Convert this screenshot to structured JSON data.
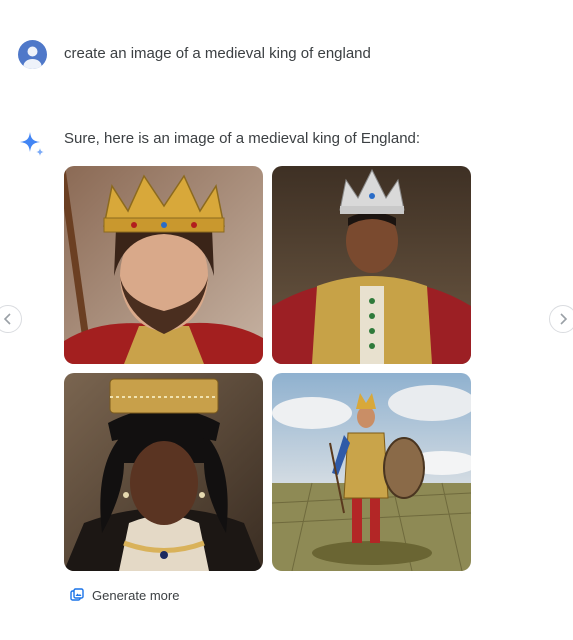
{
  "conversation": {
    "user_prompt": "create an image of a medieval king of england",
    "response_text": "Sure, here is an image of a medieval king of England:"
  },
  "images": [
    {
      "icon": "bearded-king-portrait"
    },
    {
      "icon": "king-in-jeweled-crown-portrait"
    },
    {
      "icon": "queen-in-crown-portrait"
    },
    {
      "icon": "armored-warrior-with-shield"
    }
  ],
  "actions": {
    "generate_more_label": "Generate more"
  },
  "colors": {
    "avatar": "#4f78c9",
    "sparkle_blue": "#4285f4",
    "text": "#3c4043",
    "generate_icon": "#1a73e8"
  }
}
